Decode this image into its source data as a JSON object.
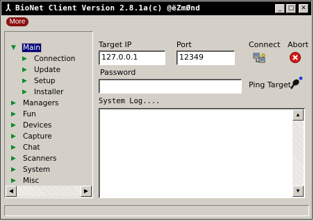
{
  "window": {
    "title": "BioNet Client Version 2.8.1a(c) @ëZmØnd",
    "minimize_glyph": "_",
    "maximize_glyph": "□",
    "close_glyph": "✕"
  },
  "menu": {
    "more_label": "More"
  },
  "tree": {
    "items": [
      {
        "label": "Main",
        "level": 0,
        "selected": true,
        "expanded": true
      },
      {
        "label": "Connection",
        "level": 1
      },
      {
        "label": "Update",
        "level": 1
      },
      {
        "label": "Setup",
        "level": 1
      },
      {
        "label": "Installer",
        "level": 1
      },
      {
        "label": "Managers",
        "level": 0
      },
      {
        "label": "Fun",
        "level": 0
      },
      {
        "label": "Devices",
        "level": 0
      },
      {
        "label": "Capture",
        "level": 0
      },
      {
        "label": "Chat",
        "level": 0
      },
      {
        "label": "Scanners",
        "level": 0
      },
      {
        "label": "System",
        "level": 0
      },
      {
        "label": "Misc",
        "level": 0
      }
    ]
  },
  "form": {
    "target_ip_label": "Target IP",
    "target_ip_value": "127.0.0.1",
    "port_label": "Port",
    "port_value": "12349",
    "password_label": "Password",
    "password_value": "",
    "connect_label": "Connect",
    "abort_label": "Abort",
    "ping_label": "Ping Target"
  },
  "log": {
    "label": "System Log....",
    "content": ""
  },
  "colors": {
    "titlebar": "#000000",
    "tree_arrow": "#0a8a2a",
    "selection": "#00007a",
    "more_button": "#8b1010",
    "abort_icon": "#d81818"
  },
  "icons": {
    "tree_collapsed": "▶",
    "tree_expanded": "▼",
    "scroll_left": "◀",
    "scroll_right": "▶",
    "scroll_up": "▲",
    "scroll_down": "▼"
  }
}
